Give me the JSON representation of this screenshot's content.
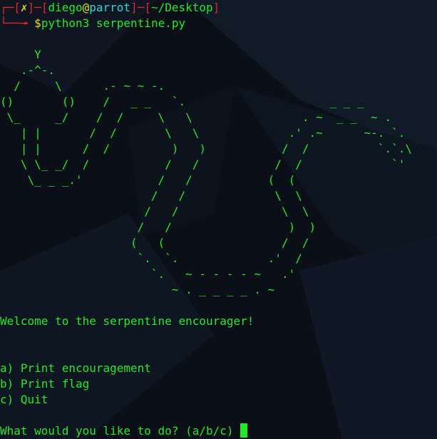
{
  "prompt": {
    "open_bracket": "┌─[",
    "status_mark": "✗",
    "mid_bracket": "]─[",
    "user": "diego",
    "at": "@",
    "host": "parrot",
    "path_open": "]─[",
    "path": "~/Desktop",
    "close_bracket": "]",
    "second_prefix": "└──╼ ",
    "dollar": "$",
    "command": "python3 serpentine.py"
  },
  "ascii_art": "     Y\n   .-^-.\n  /     \\      .- ~ ~ -.\n()       ()    /   _ _   `.                     _ _ _\n \\_     _/    /  /     \\   \\                . ~  _ _  ~ .\n   | |       /  /       \\   \\             .' .~      ~-. `.\n   | |      /  /         )   )           /  /          `.`.\\\n   \\ \\_ _/  /           /   /           /  /             `'\n    \\_ _ _.'           /   /           (  (\n                      /   /             \\  \\\n                     /   /               \\  \\\n                    /   /                 )  )\n                   (   (                 /  /\n                    `.  `.             .'  /\n                      `.   ~ - - - - ~   .'\n                         ~ . _ _ _ _ . ~",
  "welcome": "Welcome to the serpentine encourager!",
  "menu": [
    "a) Print encouragement",
    "b) Print flag",
    "c) Quit"
  ],
  "question": "What would you like to do? (a/b/c) "
}
